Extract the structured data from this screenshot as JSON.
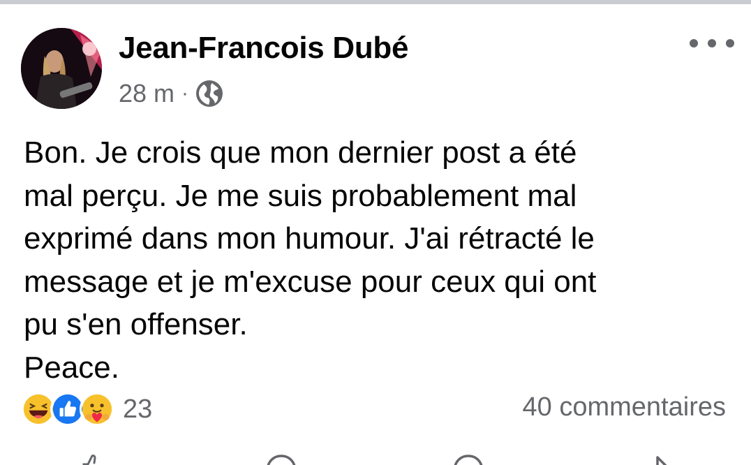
{
  "post": {
    "author": "Jean-Francois Dubé",
    "time": "28 m",
    "separator": "·",
    "audience_icon": "globe-icon",
    "more_icon": "more-options-icon",
    "text": "Bon. Je crois que mon dernier post a été\nmal perçu. Je me suis probablement mal\nexprimé dans mon humour. J'ai rétracté le\nmessage et je m'excuse pour ceux qui ont\npu s'en offenser.\nPeace."
  },
  "reactions": {
    "icons": [
      "haha-icon",
      "like-icon",
      "care-icon"
    ],
    "count": "23",
    "comments": "40 commentaires"
  },
  "actions": {
    "icons": [
      "like-action-icon",
      "comment-action-icon",
      "message-action-icon",
      "share-action-icon"
    ]
  },
  "colors": {
    "like_blue": "#1877f2",
    "reaction_yellow": "#f7c12b",
    "secondary_text": "#65676b",
    "divider": "#c9ccd1"
  }
}
